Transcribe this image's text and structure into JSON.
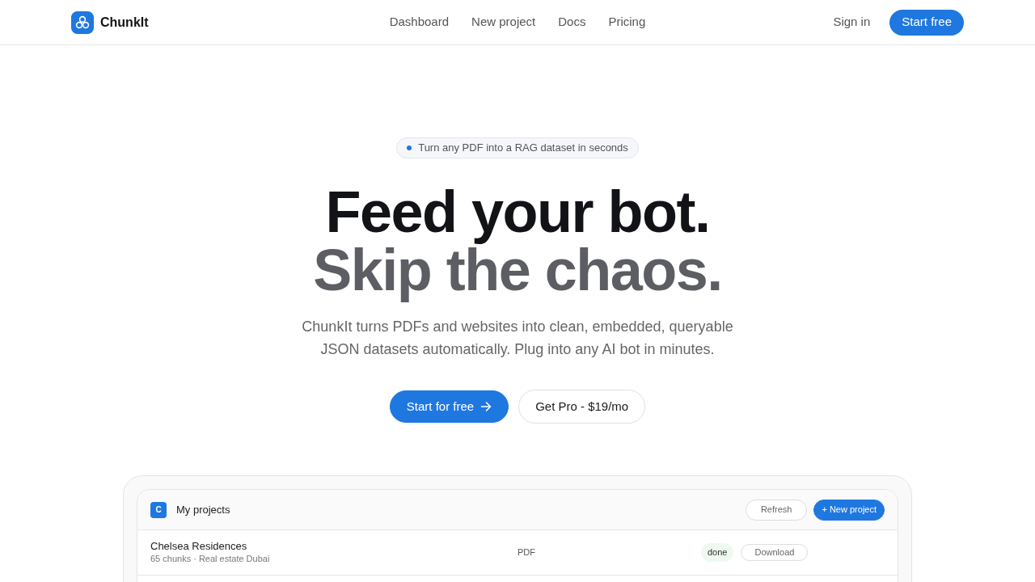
{
  "navbar": {
    "brand": "ChunkIt",
    "links": [
      {
        "label": "Dashboard"
      },
      {
        "label": "New project"
      },
      {
        "label": "Docs"
      },
      {
        "label": "Pricing"
      }
    ],
    "sign_in": "Sign in",
    "cta": "Start free"
  },
  "hero": {
    "badge": "Turn any PDF into a RAG dataset in seconds",
    "headline": [
      {
        "text": "Feed your bot.",
        "kind": "strong"
      },
      {
        "text": "Skip the chaos.",
        "kind": "muted"
      }
    ],
    "lead": "ChunkIt turns PDFs and websites into clean, embedded, queryable JSON datasets automatically. Plug into any AI bot in minutes.",
    "buttons": [
      {
        "label": "Start for free",
        "kind": "primary"
      },
      {
        "label": "Get Pro - $19/mo",
        "kind": "outline"
      }
    ]
  },
  "preview": {
    "avatar": "C",
    "title": "My projects",
    "actions": [
      {
        "label": "Refresh",
        "kind": "outline"
      },
      {
        "label": "+ New project",
        "kind": "primary"
      }
    ],
    "rows": [
      {
        "name": "Chelsea Residences",
        "meta": "65 chunks · Real estate Dubai",
        "type": "PDF",
        "status": "done",
        "action": "Download"
      }
    ]
  }
}
